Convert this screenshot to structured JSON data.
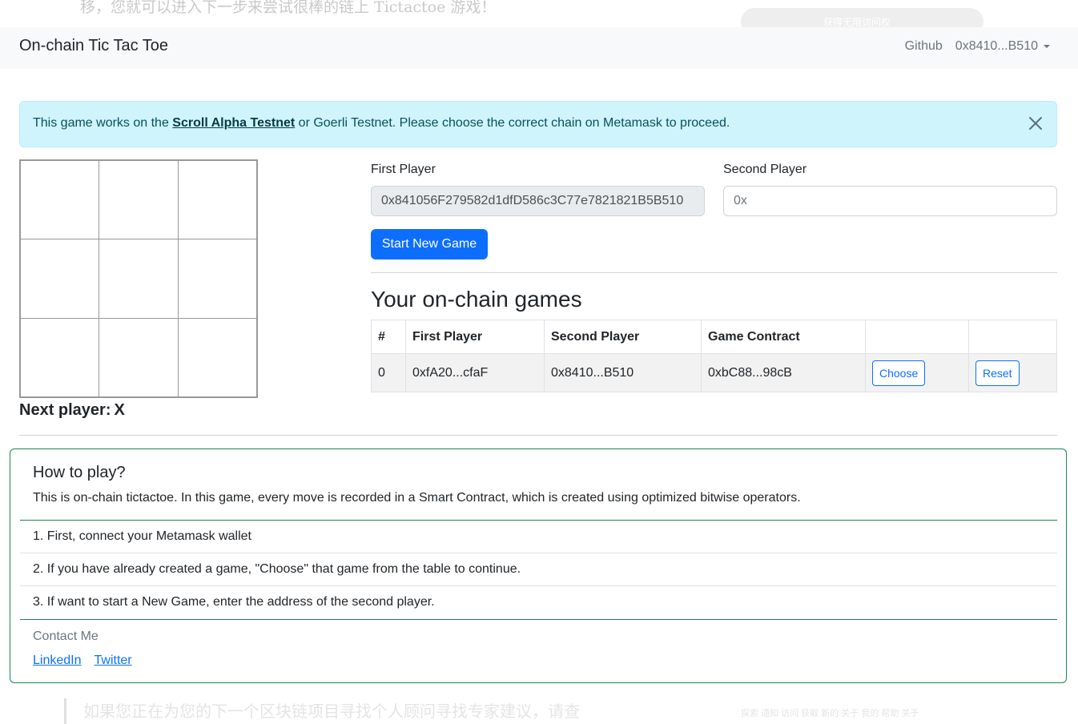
{
  "background": {
    "top_text": "移，您就可以进入下一步来尝试很棒的链上 Tictactoe 游戏！",
    "top_pill_text": "获得无限访问权",
    "bottom_text": "如果您正在为您的下一个区块链项目寻找个人顾问寻找专家建议，请查",
    "bottom_small": "探索 通知 访问 获取 新的 关于 我的 帮助 关于"
  },
  "navbar": {
    "brand": "On-chain Tic Tac Toe",
    "github_label": "Github",
    "account_label": "0x8410...B510"
  },
  "alert": {
    "text_before": "This game works on the ",
    "link_label": "Scroll Alpha Testnet",
    "text_after": " or Goerli Testnet. Please choose the correct chain on Metamask to proceed."
  },
  "board": {
    "cells": [
      "",
      "",
      "",
      "",
      "",
      "",
      "",
      "",
      ""
    ],
    "next_player_label": "Next player:",
    "next_player_value": "X"
  },
  "form": {
    "first_player_label": "First Player",
    "first_player_value": "0x841056F279582d1dfD586c3C77e7821821B5B510",
    "second_player_label": "Second Player",
    "second_player_placeholder": "0x",
    "start_button_label": "Start New Game"
  },
  "games": {
    "title": "Your on-chain games",
    "headers": [
      "#",
      "First Player",
      "Second Player",
      "Game Contract",
      "",
      ""
    ],
    "rows": [
      {
        "index": "0",
        "first_player": "0xfA20...cfaF",
        "second_player": "0x8410...B510",
        "game_contract": "0xbC88...98cB",
        "choose_label": "Choose",
        "reset_label": "Reset"
      }
    ]
  },
  "how_to_play": {
    "title": "How to play?",
    "description": "This is on-chain tictactoe. In this game, every move is recorded in a Smart Contract, which is created using optimized bitwise operators.",
    "steps": [
      "1. First, connect your Metamask wallet",
      "2. If you have already created a game, \"Choose\" that game from the table to continue.",
      "3. If want to start a New Game, enter the address of the second player."
    ],
    "contact_title": "Contact Me",
    "links": [
      "LinkedIn",
      "Twitter"
    ]
  },
  "colors": {
    "primary": "#0d6efd",
    "alert_bg": "#cff4fc",
    "alert_text": "#055160",
    "card_border": "#198754",
    "navbar_bg": "#f8f9fa"
  }
}
